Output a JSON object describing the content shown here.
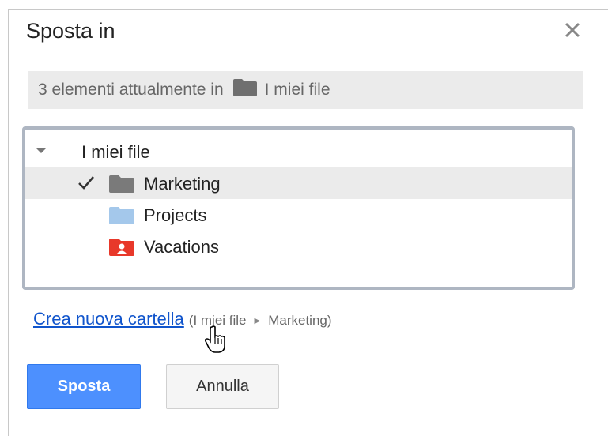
{
  "dialog": {
    "title": "Sposta in",
    "close_icon": "close-icon"
  },
  "current_location": {
    "prefix": "3 elementi attualmente in",
    "folder_icon": "folder-icon",
    "folder_name": "I miei file"
  },
  "tree": {
    "root": {
      "label": "I miei file",
      "expanded": true,
      "icon": "triangle-down-icon"
    },
    "items": [
      {
        "label": "Marketing",
        "selected": true,
        "checked": true,
        "folder_color": "#7a7a7a",
        "icon": "folder-icon"
      },
      {
        "label": "Projects",
        "selected": false,
        "checked": false,
        "folder_color": "#a4c8eb",
        "icon": "folder-icon"
      },
      {
        "label": "Vacations",
        "selected": false,
        "checked": false,
        "folder_color": "#e8382a",
        "icon": "shared-folder-icon"
      }
    ]
  },
  "new_folder": {
    "link_label": "Crea nuova cartella",
    "path_open": "(I miei file",
    "path_separator_icon": "chevron-right-icon",
    "path_close": "Marketing)"
  },
  "buttons": {
    "primary_label": "Sposta",
    "secondary_label": "Annulla"
  },
  "colors": {
    "primary": "#4d90fe",
    "link": "#1155cc",
    "selected_row": "#ebebeb"
  }
}
